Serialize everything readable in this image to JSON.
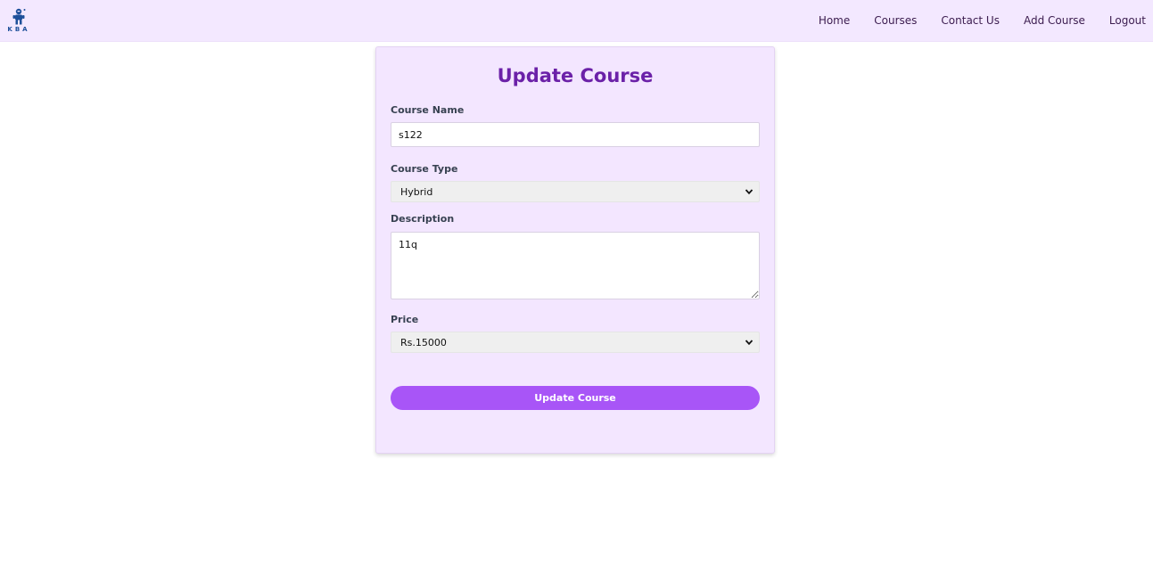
{
  "nav": {
    "logo_text": "KBA",
    "links": [
      "Home",
      "Courses",
      "Contact Us",
      "Add Course",
      "Logout"
    ]
  },
  "form": {
    "title": "Update Course",
    "course_name_label": "Course Name",
    "course_name_value": "s122",
    "course_type_label": "Course Type",
    "course_type_value": "Hybrid",
    "description_label": "Description",
    "description_value": "11q",
    "price_label": "Price",
    "price_value": "Rs.15000",
    "submit_label": "Update Course"
  },
  "colors": {
    "navbar_bg": "#f3e8ff",
    "card_bg": "#f3e6ff",
    "title": "#6b21a8",
    "button": "#a855f7",
    "logo": "#1d4f9a"
  },
  "icons": {
    "logo": "robot-logo-icon",
    "select_arrow": "chevron-down-icon",
    "textarea_grip": "resize-grip-icon"
  }
}
